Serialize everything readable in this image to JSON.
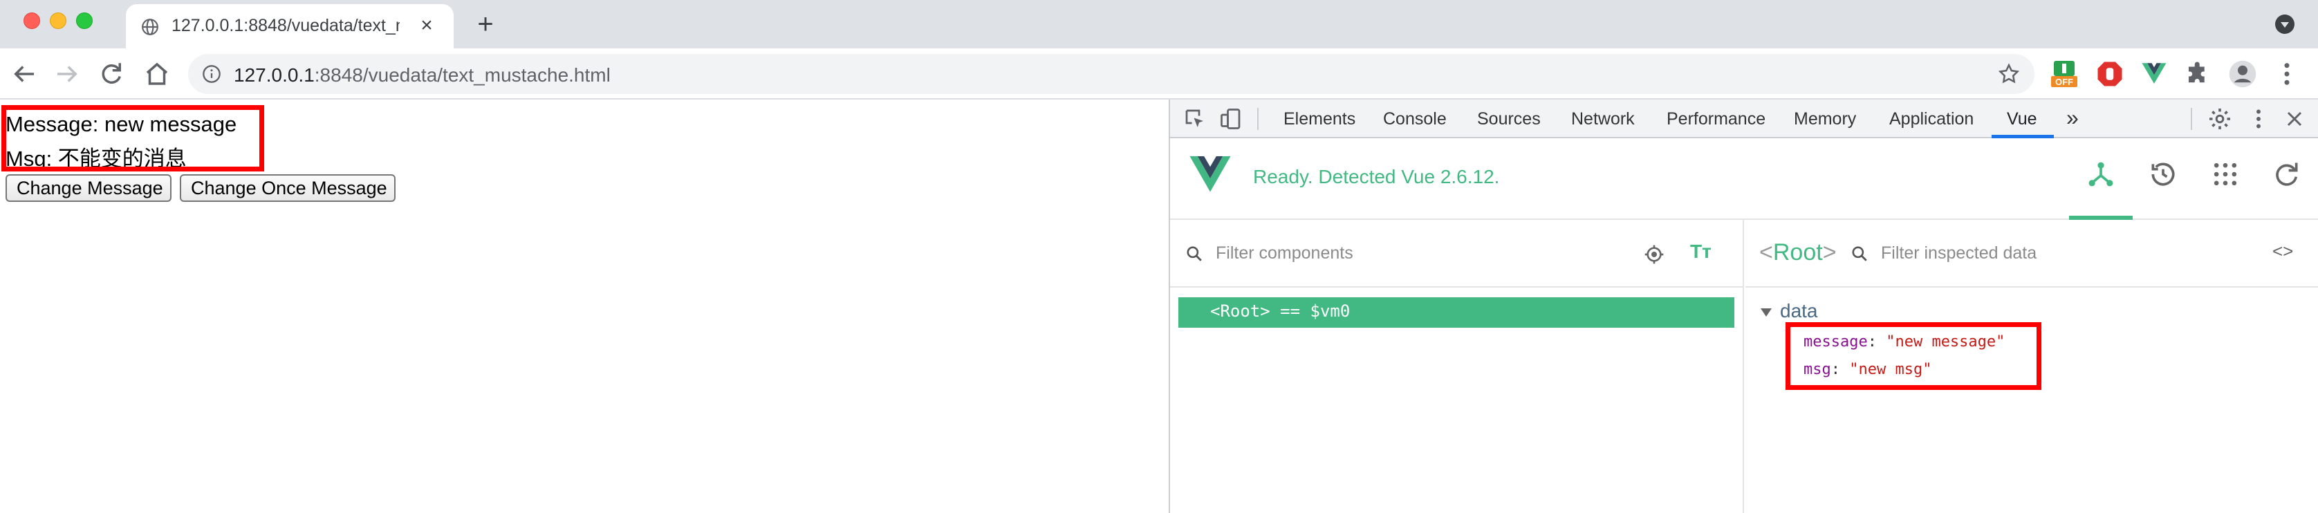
{
  "browser": {
    "tab_title": "127.0.0.1:8848/vuedata/text_mustache.html",
    "url_host": "127.0.0.1",
    "url_rest": ":8848/vuedata/text_mustache.html",
    "extension_badge": "OFF"
  },
  "page": {
    "message_line": "Message: new message",
    "msg_line": "Msg: 不能变的消息",
    "buttons": {
      "change_message": "Change Message",
      "change_once_message": "Change Once Message"
    }
  },
  "devtools": {
    "tabs": [
      "Elements",
      "Console",
      "Sources",
      "Network",
      "Performance",
      "Memory",
      "Application",
      "Vue"
    ],
    "active_tab": "Vue",
    "more_tabs": "»",
    "vue": {
      "status": "Ready. Detected Vue 2.6.12.",
      "filter_components_placeholder": "Filter components",
      "text_toggle": "Tт",
      "tree_root": "<Root> == $vm0",
      "inspected_root": "Root",
      "filter_inspected_placeholder": "Filter inspected data",
      "code_toggle": "<>",
      "data_section": "data",
      "data": [
        {
          "key": "message",
          "value": "\"new message\""
        },
        {
          "key": "msg",
          "value": "\"new msg\""
        }
      ]
    }
  },
  "colors": {
    "vue_green": "#42b983",
    "highlight_red": "#ff0000",
    "devtools_active": "#1a73e8"
  }
}
